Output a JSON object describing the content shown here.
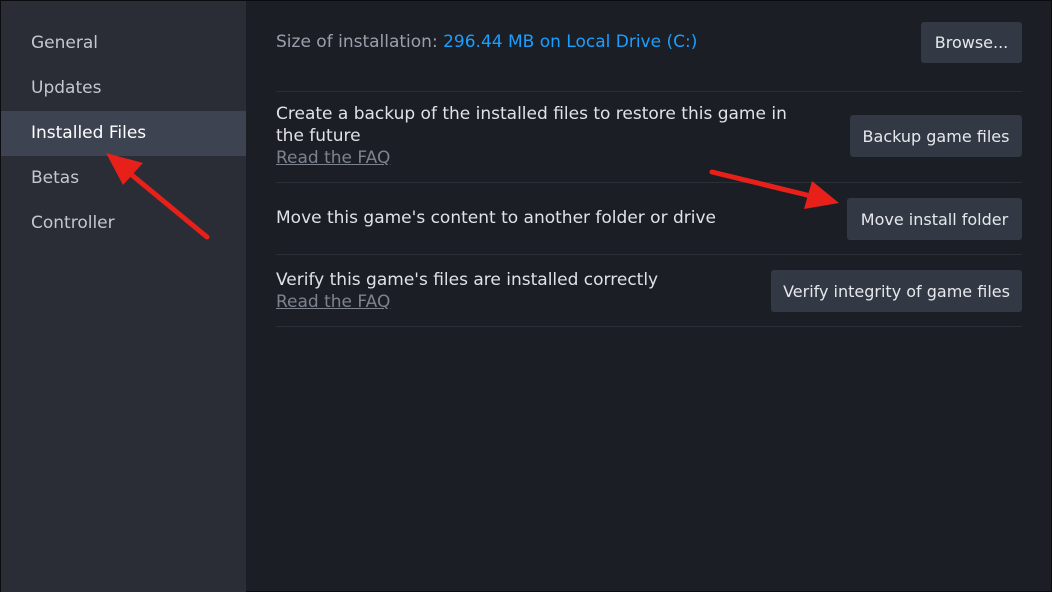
{
  "sidebar": {
    "items": [
      {
        "label": "General"
      },
      {
        "label": "Updates"
      },
      {
        "label": "Installed Files"
      },
      {
        "label": "Betas"
      },
      {
        "label": "Controller"
      }
    ]
  },
  "size": {
    "label": "Size of installation:",
    "value": "296.44 MB on Local Drive (C:)",
    "browse_label": "Browse..."
  },
  "backup": {
    "text": "Create a backup of the installed files to restore this game in the future",
    "faq": "Read the FAQ",
    "button_label": "Backup game files"
  },
  "move": {
    "text": "Move this game's content to another folder or drive",
    "button_label": "Move install folder"
  },
  "verify": {
    "text": "Verify this game's files are installed correctly",
    "faq": "Read the FAQ",
    "button_label": "Verify integrity of game files"
  },
  "colors": {
    "accent": "#1a9fff",
    "annotation_arrow": "#e8201a"
  }
}
